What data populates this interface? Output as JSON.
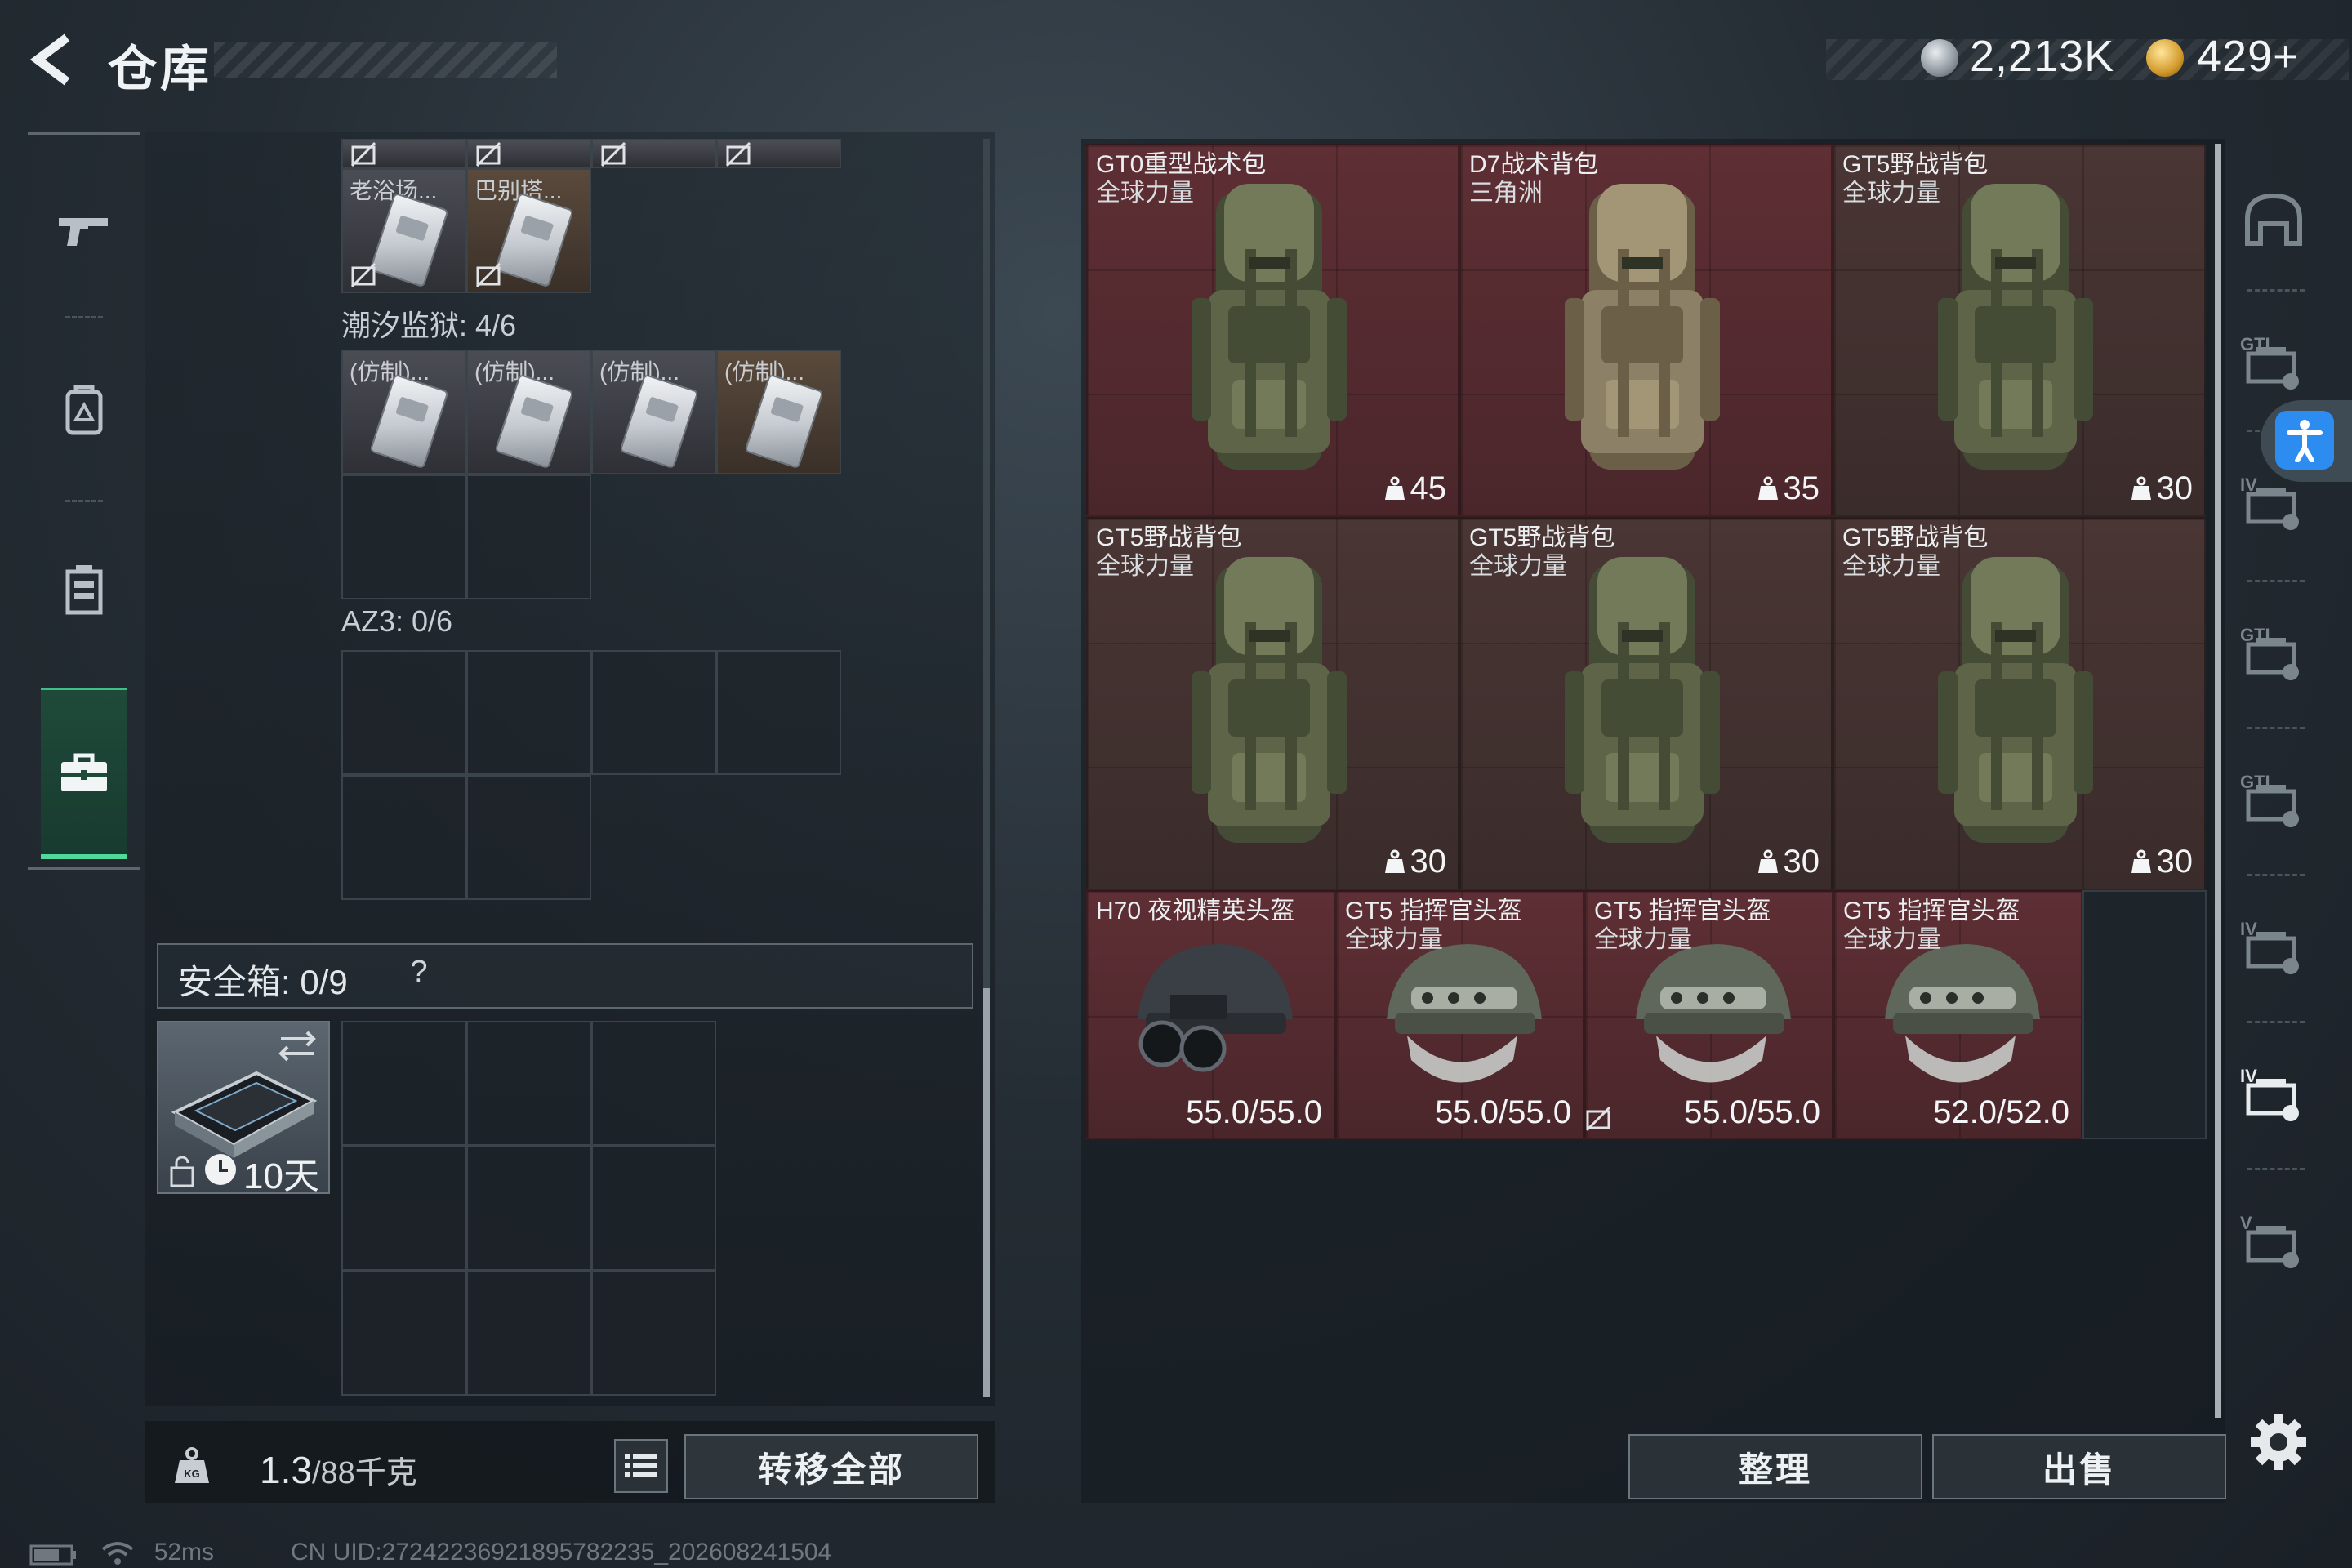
{
  "header": {
    "title": "仓库",
    "currency1": "2,213K",
    "currency2": "429+"
  },
  "left_nav": [
    "firearm-tab",
    "backpack-tab",
    "vest-tab",
    "safe-box-tab"
  ],
  "containers": {
    "top_row_names": [
      "老浴场...",
      "巴别塔..."
    ],
    "section1_label": "潮汐监狱: 4/6",
    "section1_items": [
      "(仿制)...",
      "(仿制)...",
      "(仿制)...",
      "(仿制)..."
    ],
    "section2_label": "AZ3: 0/6"
  },
  "safe": {
    "label": "安全箱: 0/9",
    "help": "?",
    "days": "10天"
  },
  "bottom_left": {
    "weight": "1.3",
    "weight_max": "/88千克",
    "transfer_all": "转移全部"
  },
  "status": {
    "ping": "52ms",
    "uid": "CN UID:27242236921895782235_202608241504"
  },
  "stash": {
    "items": [
      {
        "name": "GT0重型战术包",
        "sub": "全球力量",
        "value": "45",
        "kind": "backpack",
        "tint": "red"
      },
      {
        "name": "D7战术背包",
        "sub": "三角洲",
        "value": "35",
        "kind": "backpack-tan",
        "tint": "red"
      },
      {
        "name": "GT5野战背包",
        "sub": "全球力量",
        "value": "30",
        "kind": "backpack",
        "tint": "brown"
      },
      {
        "name": "GT5野战背包",
        "sub": "全球力量",
        "value": "30",
        "kind": "backpack",
        "tint": "brown"
      },
      {
        "name": "GT5野战背包",
        "sub": "全球力量",
        "value": "30",
        "kind": "backpack",
        "tint": "brown"
      },
      {
        "name": "GT5野战背包",
        "sub": "全球力量",
        "value": "30",
        "kind": "backpack",
        "tint": "brown"
      },
      {
        "name": "H70 夜视精英头盔",
        "sub": "",
        "value": "55.0/55.0",
        "kind": "helmet-nv",
        "tint": "red"
      },
      {
        "name": "GT5 指挥官头盔",
        "sub": "全球力量",
        "value": "55.0/55.0",
        "kind": "helmet",
        "tint": "red"
      },
      {
        "name": "GT5 指挥官头盔",
        "sub": "全球力量",
        "value": "55.0/55.0",
        "kind": "helmet",
        "tint": "red"
      },
      {
        "name": "GT5 指挥官头盔",
        "sub": "全球力量",
        "value": "52.0/52.0",
        "kind": "helmet",
        "tint": "red"
      }
    ],
    "sort": "整理",
    "sell": "出售"
  },
  "right_nav": [
    "helmet-tab",
    "backpack-gti-tab",
    "backpack-iv-tab",
    "armor-gti-tab",
    "armor-gti-2-tab",
    "armor-iv-tab",
    "case-iv-tab",
    "case-v-tab"
  ],
  "colors": {
    "accent_green": "#4fd99b",
    "rarity_red": "#5e2f34",
    "rarity_brown": "#4a3634",
    "access_blue": "#2d8cf0"
  }
}
